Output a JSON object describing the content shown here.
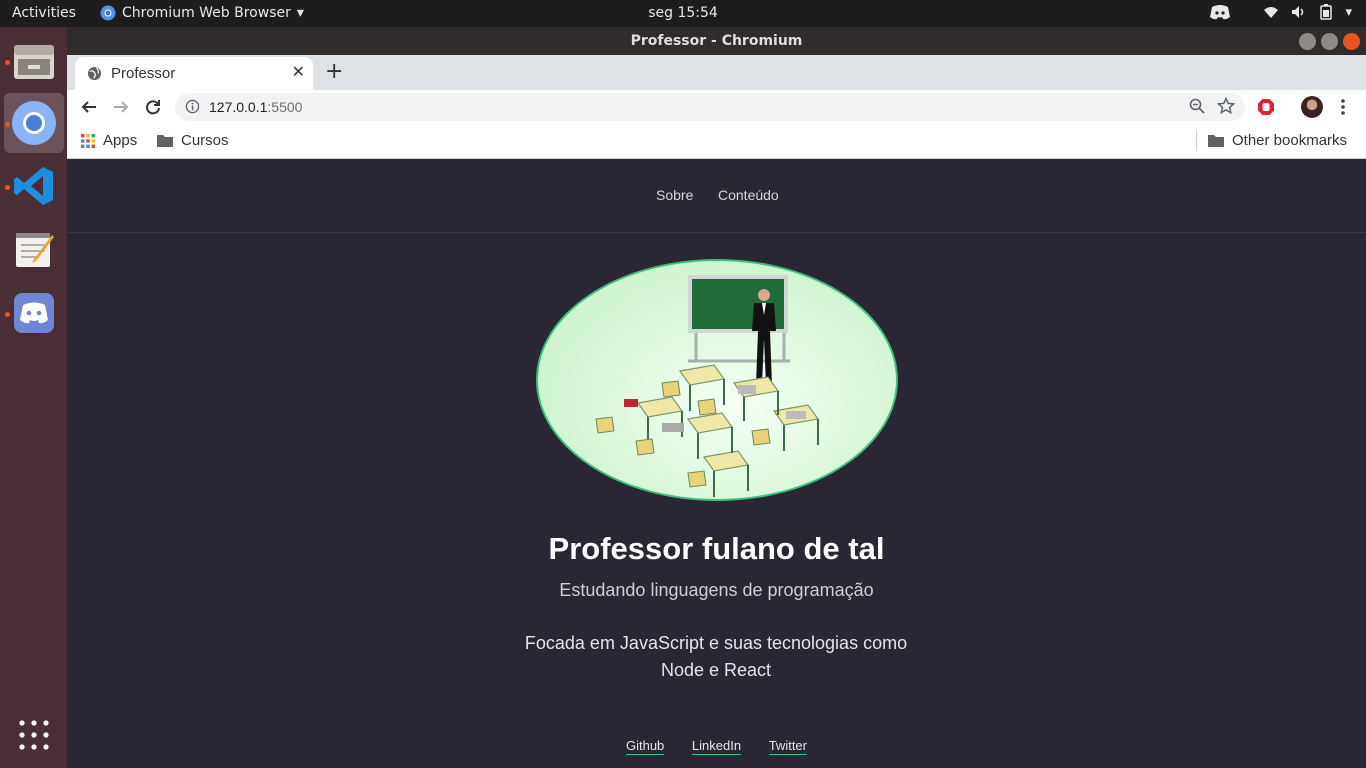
{
  "system": {
    "activities": "Activities",
    "app_menu": "Chromium Web Browser",
    "clock": "seg 15:54"
  },
  "window": {
    "title": "Professor - Chromium"
  },
  "browser": {
    "tab_title": "Professor",
    "url_host": "127.0.0.1",
    "url_port": ":5500",
    "bookmarks": {
      "apps": "Apps",
      "folder": "Cursos",
      "other": "Other bookmarks"
    }
  },
  "page": {
    "nav": [
      "Sobre",
      "Conteúdo"
    ],
    "title": "Professor fulano de tal",
    "subtitle": "Estudando linguagens de programação",
    "description_line1": "Focada em JavaScript e suas tecnologias como",
    "description_line2": "Node e React",
    "links": [
      "Github",
      "LinkedIn",
      "Twitter"
    ]
  },
  "colors": {
    "page_bg": "#2a2633",
    "accent": "#37c47f",
    "ubuntu_orange": "#e95420"
  },
  "icons": [
    "discord-icon",
    "wifi-icon",
    "volume-icon",
    "battery-icon",
    "files-icon",
    "chromium-icon",
    "vscode-icon",
    "text-editor-icon",
    "apps-grid-icon",
    "globe-icon",
    "info-icon",
    "zoom-icon",
    "star-icon",
    "adblock-icon",
    "avatar",
    "menu-icon",
    "folder-icon"
  ]
}
